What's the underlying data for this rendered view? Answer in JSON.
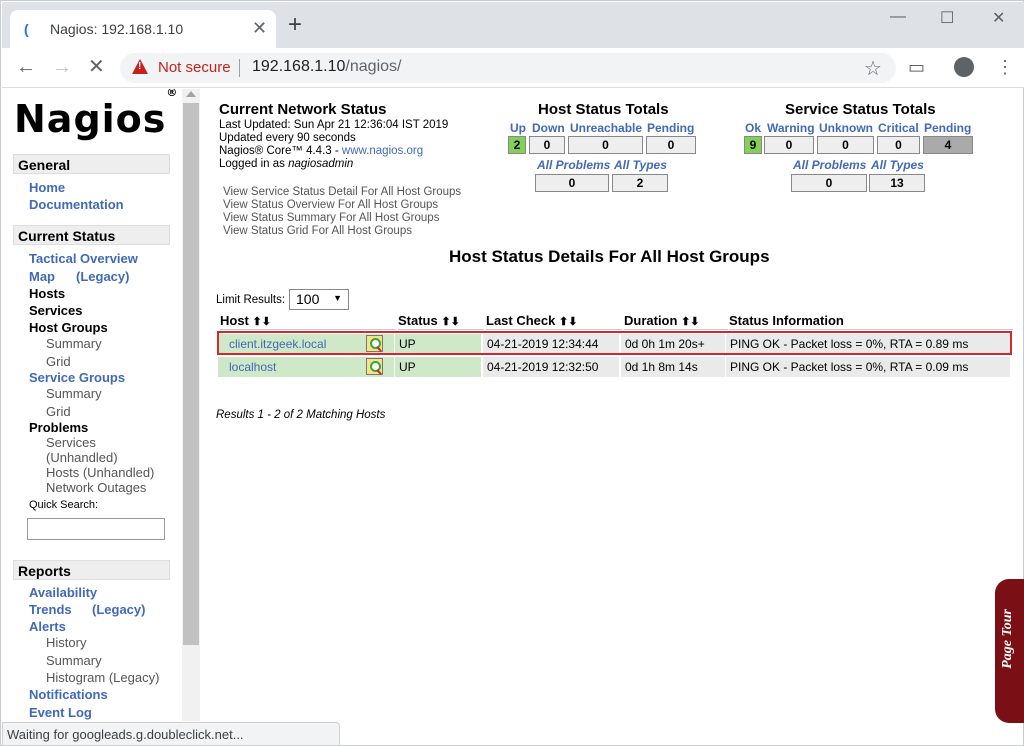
{
  "tab": {
    "title": "Nagios: 192.168.1.10",
    "close": "✕",
    "new_tab": "+"
  },
  "window": {
    "minimize": "—",
    "maximize": "☐",
    "close": "✕"
  },
  "toolbar": {
    "back": "←",
    "forward": "→",
    "stop": "✕",
    "not_secure": "Not secure",
    "url_host": "192.168.1.10",
    "url_path": "/nagios/",
    "star": "☆",
    "cast_icon": "▭",
    "menu_icon": "⋮"
  },
  "sidebar": {
    "logo": "Nagios",
    "logo_mark": "®",
    "general": "General",
    "home": "Home",
    "documentation": "Documentation",
    "current_status": "Current Status",
    "tactical_overview": "Tactical Overview",
    "map": "Map",
    "map_legacy": "(Legacy)",
    "hosts": "Hosts",
    "services": "Services",
    "host_groups": "Host Groups",
    "hg_summary": "Summary",
    "hg_grid": "Grid",
    "service_groups": "Service Groups",
    "sg_summary": "Summary",
    "sg_grid": "Grid",
    "problems": "Problems",
    "prob_services": "Services",
    "prob_services_unhandled": "(Unhandled)",
    "prob_hosts_unhandled": "Hosts (Unhandled)",
    "network_outages": "Network Outages",
    "quick_search": "Quick Search:",
    "reports": "Reports",
    "availability": "Availability",
    "trends": "Trends",
    "trends_legacy": "(Legacy)",
    "alerts": "Alerts",
    "alerts_history": "History",
    "alerts_summary": "Summary",
    "alerts_histogram": "Histogram (Legacy)",
    "notifications": "Notifications",
    "event_log": "Event Log"
  },
  "status": {
    "title": "Current Network Status",
    "last_updated": "Last Updated: Sun Apr 21 12:36:04 IST 2019",
    "update_interval": "Updated every 90 seconds",
    "core_version": "Nagios® Core™ 4.4.3 -",
    "core_link": "www.nagios.org",
    "logged_in_prefix": "Logged in as",
    "logged_in_user": "nagiosadmin",
    "links": [
      "View Service Status Detail For All Host Groups",
      "View Status Overview For All Host Groups",
      "View Status Summary For All Host Groups",
      "View Status Grid For All Host Groups"
    ]
  },
  "host_totals": {
    "title": "Host Status Totals",
    "up_label": "Up",
    "down_label": "Down",
    "unreachable_label": "Unreachable",
    "pending_label": "Pending",
    "up": "2",
    "down": "0",
    "unreachable": "0",
    "pending": "0",
    "all_problems_label": "All Problems",
    "all_types_label": "All Types",
    "all_problems": "0",
    "all_types": "2"
  },
  "service_totals": {
    "title": "Service Status Totals",
    "ok_label": "Ok",
    "warning_label": "Warning",
    "unknown_label": "Unknown",
    "critical_label": "Critical",
    "pending_label": "Pending",
    "ok": "9",
    "warning": "0",
    "unknown": "0",
    "critical": "0",
    "pending": "4",
    "all_problems_label": "All Problems",
    "all_types_label": "All Types",
    "all_problems": "0",
    "all_types": "13"
  },
  "details": {
    "title": "Host Status Details For All Host Groups",
    "limit_label": "Limit Results:",
    "limit_value": "100",
    "columns": {
      "host": "Host",
      "status": "Status",
      "last_check": "Last Check",
      "duration": "Duration",
      "info": "Status Information"
    },
    "sort_icon": "⬆⬇",
    "rows": [
      {
        "host": "client.itzgeek.local",
        "status": "UP",
        "last_check": "04-21-2019 12:34:44",
        "duration": "0d 0h 1m 20s+",
        "info": "PING OK - Packet loss = 0%, RTA = 0.89 ms"
      },
      {
        "host": "localhost",
        "status": "UP",
        "last_check": "04-21-2019 12:32:50",
        "duration": "0d 1h 8m 14s",
        "info": "PING OK - Packet loss = 0%, RTA = 0.09 ms"
      }
    ],
    "results": "Results 1 - 2 of 2 Matching Hosts"
  },
  "page_tour": "Page Tour",
  "status_bar": "Waiting for googleads.g.doubleclick.net..."
}
